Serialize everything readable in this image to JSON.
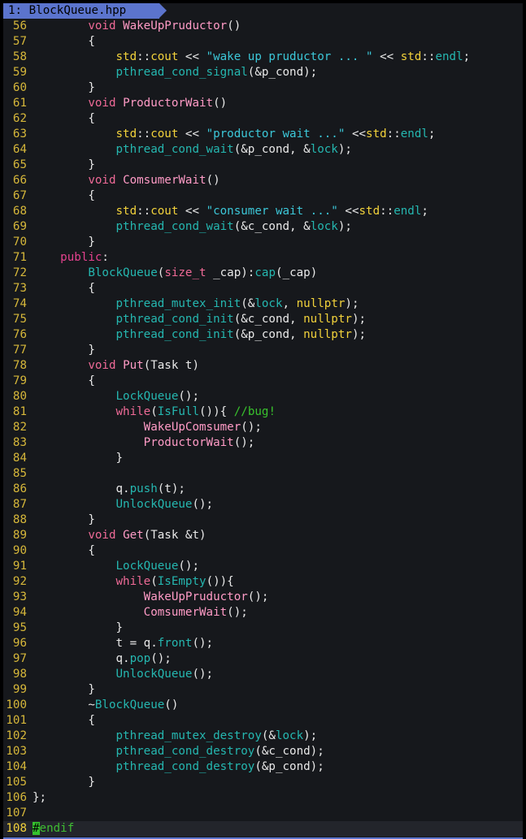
{
  "tab": {
    "label": "1: BlockQueue.hpp"
  },
  "colors": {
    "background": "#16181c",
    "tab": "#5b74cd",
    "line_number": "#d6b73a",
    "keyword": "#ef6a97",
    "type": "#f2d23b",
    "function": "#ff9bc6",
    "library_call": "#25b7b0",
    "string": "#3cc7d8",
    "comment": "#39c22d",
    "cursor": "#35c22d"
  },
  "current_line": 108,
  "lines": [
    {
      "n": "56",
      "tokens": [
        [
          "        ",
          "id"
        ],
        [
          "void ",
          "kw"
        ],
        [
          "WakeUpPruductor",
          "fn"
        ],
        [
          "()",
          "id"
        ]
      ]
    },
    {
      "n": "57",
      "tokens": [
        [
          "        {",
          "id"
        ]
      ]
    },
    {
      "n": "58",
      "tokens": [
        [
          "            ",
          "id"
        ],
        [
          "std",
          "ty"
        ],
        [
          "::",
          "id"
        ],
        [
          "cout",
          "ty"
        ],
        [
          " << ",
          "id"
        ],
        [
          "\"wake up pruductor ... \"",
          "str"
        ],
        [
          " << ",
          "id"
        ],
        [
          "std",
          "ty"
        ],
        [
          "::",
          "id"
        ],
        [
          "endl",
          "lib"
        ],
        [
          ";",
          "id"
        ]
      ]
    },
    {
      "n": "59",
      "tokens": [
        [
          "            ",
          "id"
        ],
        [
          "pthread_cond_signal",
          "lib"
        ],
        [
          "(&p_cond);",
          "id"
        ]
      ]
    },
    {
      "n": "60",
      "tokens": [
        [
          "        }",
          "id"
        ]
      ]
    },
    {
      "n": "61",
      "tokens": [
        [
          "        ",
          "id"
        ],
        [
          "void ",
          "kw"
        ],
        [
          "ProductorWait",
          "fn"
        ],
        [
          "()",
          "id"
        ]
      ]
    },
    {
      "n": "62",
      "tokens": [
        [
          "        {",
          "id"
        ]
      ]
    },
    {
      "n": "63",
      "tokens": [
        [
          "            ",
          "id"
        ],
        [
          "std",
          "ty"
        ],
        [
          "::",
          "id"
        ],
        [
          "cout",
          "ty"
        ],
        [
          " << ",
          "id"
        ],
        [
          "\"productor wait ...\"",
          "str"
        ],
        [
          " <<",
          "id"
        ],
        [
          "std",
          "ty"
        ],
        [
          "::",
          "id"
        ],
        [
          "endl",
          "lib"
        ],
        [
          ";",
          "id"
        ]
      ]
    },
    {
      "n": "64",
      "tokens": [
        [
          "            ",
          "id"
        ],
        [
          "pthread_cond_wait",
          "lib"
        ],
        [
          "(&p_cond, &",
          "id"
        ],
        [
          "lock",
          "lib"
        ],
        [
          ");",
          "id"
        ]
      ]
    },
    {
      "n": "65",
      "tokens": [
        [
          "        }",
          "id"
        ]
      ]
    },
    {
      "n": "66",
      "tokens": [
        [
          "        ",
          "id"
        ],
        [
          "void ",
          "kw"
        ],
        [
          "ComsumerWait",
          "fn"
        ],
        [
          "()",
          "id"
        ]
      ]
    },
    {
      "n": "67",
      "tokens": [
        [
          "        {",
          "id"
        ]
      ]
    },
    {
      "n": "68",
      "tokens": [
        [
          "            ",
          "id"
        ],
        [
          "std",
          "ty"
        ],
        [
          "::",
          "id"
        ],
        [
          "cout",
          "ty"
        ],
        [
          " << ",
          "id"
        ],
        [
          "\"consumer wait ...\"",
          "str"
        ],
        [
          " <<",
          "id"
        ],
        [
          "std",
          "ty"
        ],
        [
          "::",
          "id"
        ],
        [
          "endl",
          "lib"
        ],
        [
          ";",
          "id"
        ]
      ]
    },
    {
      "n": "69",
      "tokens": [
        [
          "            ",
          "id"
        ],
        [
          "pthread_cond_wait",
          "lib"
        ],
        [
          "(&c_cond, &",
          "id"
        ],
        [
          "lock",
          "lib"
        ],
        [
          ");",
          "id"
        ]
      ]
    },
    {
      "n": "70",
      "tokens": [
        [
          "        }",
          "id"
        ]
      ]
    },
    {
      "n": "71",
      "tokens": [
        [
          "    ",
          "id"
        ],
        [
          "public",
          "kw2"
        ],
        [
          ":",
          "id"
        ]
      ]
    },
    {
      "n": "72",
      "tokens": [
        [
          "        ",
          "id"
        ],
        [
          "BlockQueue",
          "lib"
        ],
        [
          "(",
          "id"
        ],
        [
          "size_t",
          "kw"
        ],
        [
          " _cap):",
          "id"
        ],
        [
          "cap",
          "lib"
        ],
        [
          "(_cap)",
          "id"
        ]
      ]
    },
    {
      "n": "73",
      "tokens": [
        [
          "        {",
          "id"
        ]
      ]
    },
    {
      "n": "74",
      "tokens": [
        [
          "            ",
          "id"
        ],
        [
          "pthread_mutex_init",
          "lib"
        ],
        [
          "(&",
          "id"
        ],
        [
          "lock",
          "lib"
        ],
        [
          ", ",
          "id"
        ],
        [
          "nullptr",
          "ty"
        ],
        [
          ");",
          "id"
        ]
      ]
    },
    {
      "n": "75",
      "tokens": [
        [
          "            ",
          "id"
        ],
        [
          "pthread_cond_init",
          "lib"
        ],
        [
          "(&c_cond, ",
          "id"
        ],
        [
          "nullptr",
          "ty"
        ],
        [
          ");",
          "id"
        ]
      ]
    },
    {
      "n": "76",
      "tokens": [
        [
          "            ",
          "id"
        ],
        [
          "pthread_cond_init",
          "lib"
        ],
        [
          "(&p_cond, ",
          "id"
        ],
        [
          "nullptr",
          "ty"
        ],
        [
          ");",
          "id"
        ]
      ]
    },
    {
      "n": "77",
      "tokens": [
        [
          "        }",
          "id"
        ]
      ]
    },
    {
      "n": "78",
      "tokens": [
        [
          "        ",
          "id"
        ],
        [
          "void ",
          "kw"
        ],
        [
          "Put",
          "fn"
        ],
        [
          "(Task t)",
          "id"
        ]
      ]
    },
    {
      "n": "79",
      "tokens": [
        [
          "        {",
          "id"
        ]
      ]
    },
    {
      "n": "80",
      "tokens": [
        [
          "            ",
          "id"
        ],
        [
          "LockQueue",
          "lib"
        ],
        [
          "();",
          "id"
        ]
      ]
    },
    {
      "n": "81",
      "tokens": [
        [
          "            ",
          "id"
        ],
        [
          "while",
          "kw"
        ],
        [
          "(",
          "id"
        ],
        [
          "IsFull",
          "lib"
        ],
        [
          "()){ ",
          "id"
        ],
        [
          "//bug!",
          "cm"
        ]
      ]
    },
    {
      "n": "82",
      "tokens": [
        [
          "                ",
          "id"
        ],
        [
          "WakeUpComsumer",
          "fn"
        ],
        [
          "();",
          "id"
        ]
      ]
    },
    {
      "n": "83",
      "tokens": [
        [
          "                ",
          "id"
        ],
        [
          "ProductorWait",
          "fn"
        ],
        [
          "();",
          "id"
        ]
      ]
    },
    {
      "n": "84",
      "tokens": [
        [
          "            }",
          "id"
        ]
      ]
    },
    {
      "n": "85",
      "tokens": [
        [
          "",
          "id"
        ]
      ]
    },
    {
      "n": "86",
      "tokens": [
        [
          "            q.",
          "id"
        ],
        [
          "push",
          "lib"
        ],
        [
          "(t);",
          "id"
        ]
      ]
    },
    {
      "n": "87",
      "tokens": [
        [
          "            ",
          "id"
        ],
        [
          "UnlockQueue",
          "lib"
        ],
        [
          "();",
          "id"
        ]
      ]
    },
    {
      "n": "88",
      "tokens": [
        [
          "        }",
          "id"
        ]
      ]
    },
    {
      "n": "89",
      "tokens": [
        [
          "        ",
          "id"
        ],
        [
          "void ",
          "kw"
        ],
        [
          "Get",
          "fn"
        ],
        [
          "(Task &t)",
          "id"
        ]
      ]
    },
    {
      "n": "90",
      "tokens": [
        [
          "        {",
          "id"
        ]
      ]
    },
    {
      "n": "91",
      "tokens": [
        [
          "            ",
          "id"
        ],
        [
          "LockQueue",
          "lib"
        ],
        [
          "();",
          "id"
        ]
      ]
    },
    {
      "n": "92",
      "tokens": [
        [
          "            ",
          "id"
        ],
        [
          "while",
          "kw"
        ],
        [
          "(",
          "id"
        ],
        [
          "IsEmpty",
          "lib"
        ],
        [
          "()){",
          "id"
        ]
      ]
    },
    {
      "n": "93",
      "tokens": [
        [
          "                ",
          "id"
        ],
        [
          "WakeUpPruductor",
          "fn"
        ],
        [
          "();",
          "id"
        ]
      ]
    },
    {
      "n": "94",
      "tokens": [
        [
          "                ",
          "id"
        ],
        [
          "ComsumerWait",
          "fn"
        ],
        [
          "();",
          "id"
        ]
      ]
    },
    {
      "n": "95",
      "tokens": [
        [
          "            }",
          "id"
        ]
      ]
    },
    {
      "n": "96",
      "tokens": [
        [
          "            t = q.",
          "id"
        ],
        [
          "front",
          "lib"
        ],
        [
          "();",
          "id"
        ]
      ]
    },
    {
      "n": "97",
      "tokens": [
        [
          "            q.",
          "id"
        ],
        [
          "pop",
          "lib"
        ],
        [
          "();",
          "id"
        ]
      ]
    },
    {
      "n": "98",
      "tokens": [
        [
          "            ",
          "id"
        ],
        [
          "UnlockQueue",
          "lib"
        ],
        [
          "();",
          "id"
        ]
      ]
    },
    {
      "n": "99",
      "tokens": [
        [
          "        }",
          "id"
        ]
      ]
    },
    {
      "n": "100",
      "tokens": [
        [
          "        ~",
          "id"
        ],
        [
          "BlockQueue",
          "lib"
        ],
        [
          "()",
          "id"
        ]
      ]
    },
    {
      "n": "101",
      "tokens": [
        [
          "        {",
          "id"
        ]
      ]
    },
    {
      "n": "102",
      "tokens": [
        [
          "            ",
          "id"
        ],
        [
          "pthread_mutex_destroy",
          "lib"
        ],
        [
          "(&",
          "id"
        ],
        [
          "lock",
          "lib"
        ],
        [
          ");",
          "id"
        ]
      ]
    },
    {
      "n": "103",
      "tokens": [
        [
          "            ",
          "id"
        ],
        [
          "pthread_cond_destroy",
          "lib"
        ],
        [
          "(&c_cond);",
          "id"
        ]
      ]
    },
    {
      "n": "104",
      "tokens": [
        [
          "            ",
          "id"
        ],
        [
          "pthread_cond_destroy",
          "lib"
        ],
        [
          "(&p_cond);",
          "id"
        ]
      ]
    },
    {
      "n": "105",
      "tokens": [
        [
          "        }",
          "id"
        ]
      ]
    },
    {
      "n": "106",
      "tokens": [
        [
          "};",
          "id"
        ]
      ]
    },
    {
      "n": "107",
      "tokens": [
        [
          "",
          "id"
        ]
      ]
    },
    {
      "n": "108",
      "tokens": [
        [
          "#",
          "cursor"
        ],
        [
          "endif",
          "pp"
        ]
      ]
    }
  ]
}
